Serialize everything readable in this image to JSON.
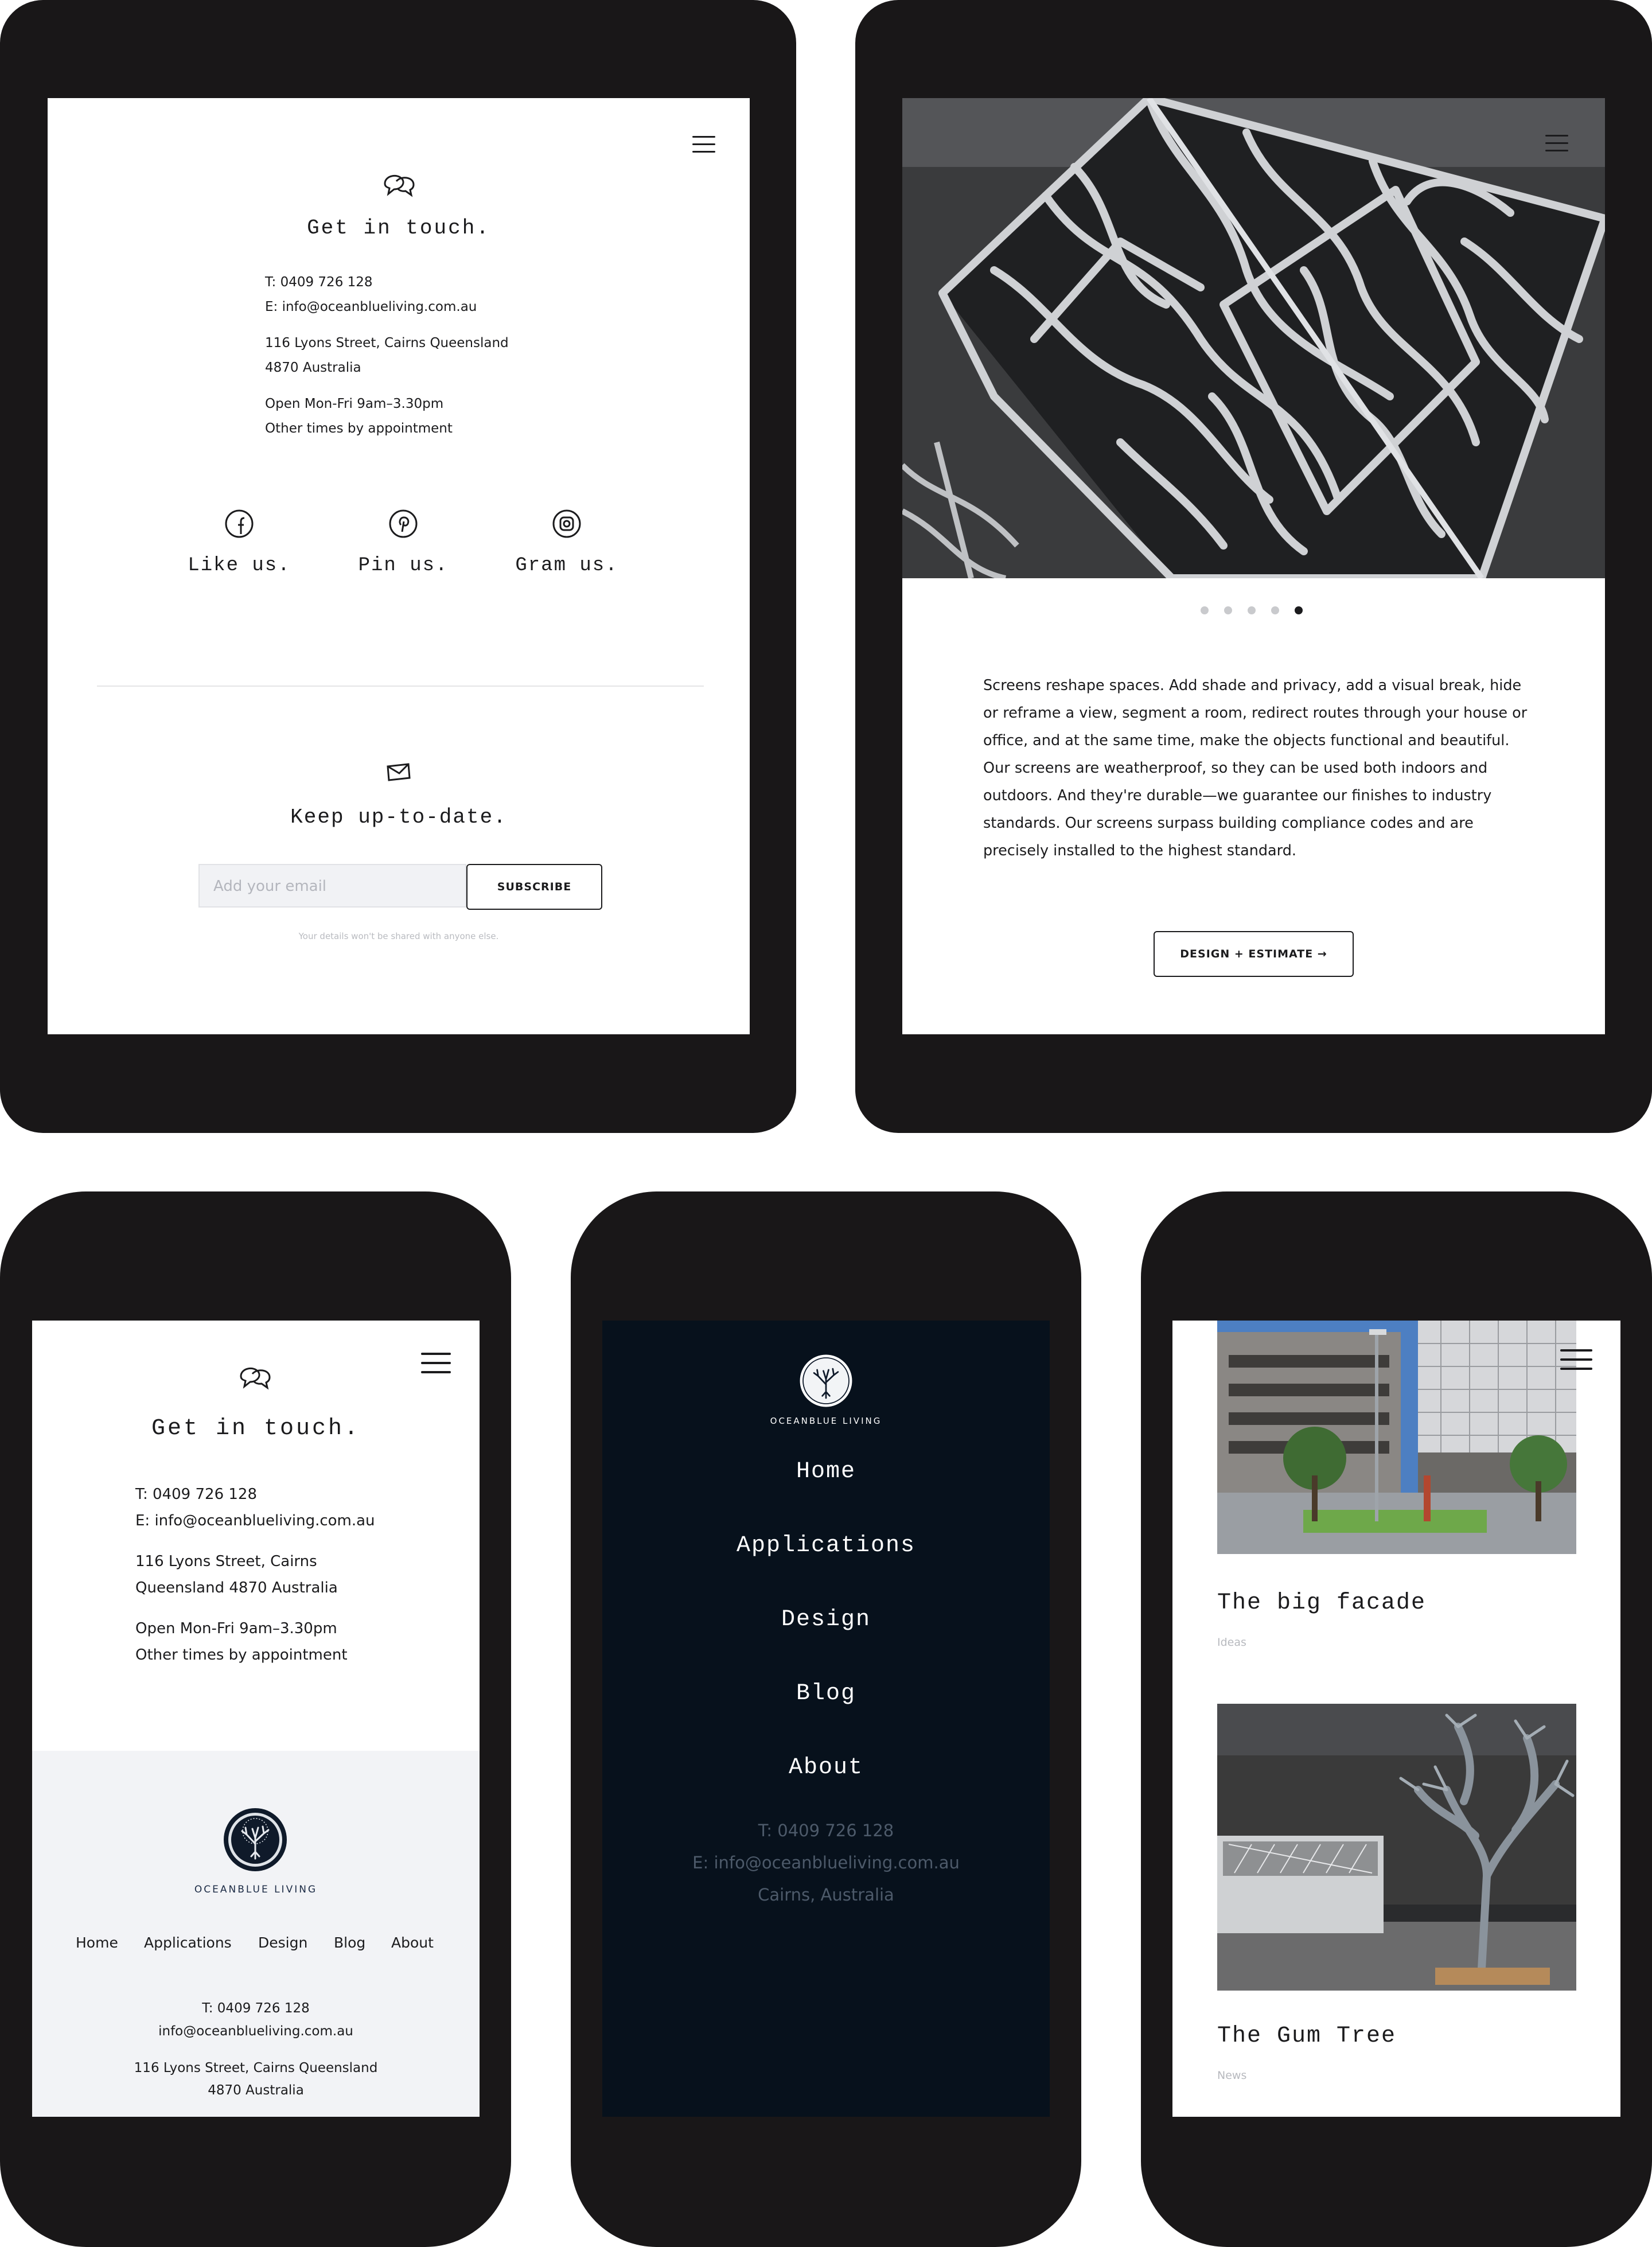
{
  "contact": {
    "title": "Get in touch.",
    "phone": "T: 0409 726 128",
    "email": "E: info@oceanblueliving.com.au",
    "address_line1": "116 Lyons Street, Cairns Queensland",
    "address_line2": "4870 Australia",
    "hours_line1": "Open Mon-Fri 9am–3.30pm",
    "hours_line2": "Other times by appointment"
  },
  "phone_contact": {
    "address_line1": "116 Lyons Street, Cairns",
    "address_line2": "Queensland 4870 Australia"
  },
  "social": [
    {
      "icon": "facebook-icon",
      "label": "Like us."
    },
    {
      "icon": "pinterest-icon",
      "label": "Pin us."
    },
    {
      "icon": "instagram-icon",
      "label": "Gram us."
    }
  ],
  "newsletter": {
    "title": "Keep up-to-date.",
    "placeholder": "Add your email",
    "button": "SUBSCRIBE",
    "note": "Your details won't be shared with anyone else."
  },
  "screens": {
    "body": [
      "Screens reshape spaces. Add shade and privacy, add a visual break, hide",
      "or reframe a view, segment a room, redirect routes through your house or",
      "office, and at the same time, make the objects functional and beautiful.",
      "Our screens are weatherproof, so they can be used both indoors and",
      "outdoors. And they're durable—we guarantee our finishes to industry",
      "standards. Our screens surpass building compliance codes and are",
      "precisely installed to the highest standard."
    ],
    "cta": "DESIGN + ESTIMATE →",
    "carousel_active": 5,
    "carousel_count": 5
  },
  "brand": {
    "name": "OCEANBLUE LIVING"
  },
  "footer": {
    "nav": [
      "Home",
      "Applications",
      "Design",
      "Blog",
      "About"
    ],
    "phone": "T: 0409 726 128",
    "email": "info@oceanblueliving.com.au",
    "address_line1": "116 Lyons Street, Cairns Queensland",
    "address_line2": "4870 Australia"
  },
  "menu": {
    "items": [
      "Home",
      "Applications",
      "Design",
      "Blog",
      "About"
    ],
    "phone": "T: 0409 726 128",
    "email": "E: info@oceanblueliving.com.au",
    "location": "Cairns, Australia"
  },
  "blog": {
    "posts": [
      {
        "title": "The big facade",
        "category": "Ideas"
      },
      {
        "title": "The Gum Tree",
        "category": "News"
      }
    ]
  },
  "colors": {
    "device": "#191718",
    "menu_bg": "#07111c",
    "footer_bg": "#f2f3f6",
    "text": "#1b1b1d"
  }
}
